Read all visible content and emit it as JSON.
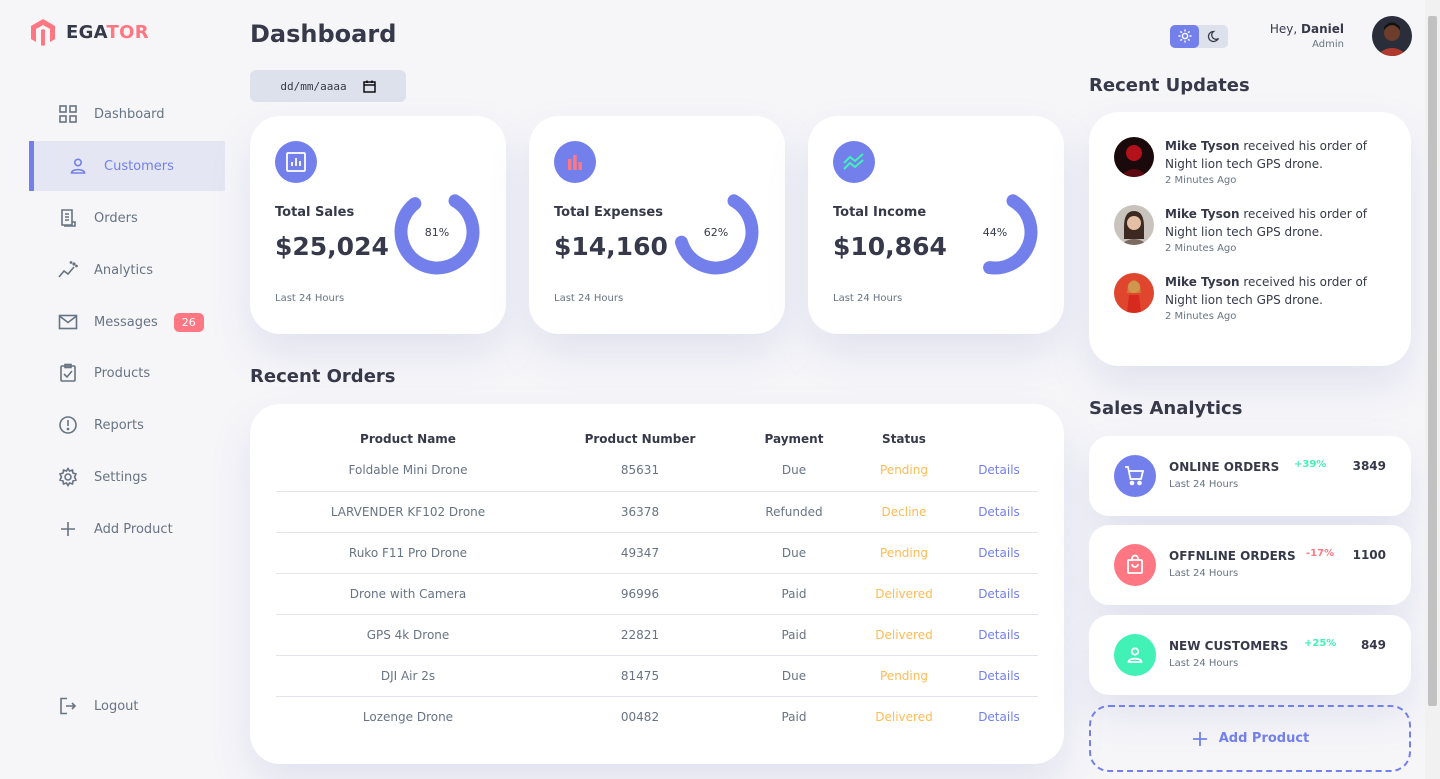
{
  "brand": {
    "name_main": "EGA",
    "name_accent": "TOR"
  },
  "sidebar": {
    "items": [
      {
        "label": "Dashboard",
        "icon": "grid-icon"
      },
      {
        "label": "Customers",
        "icon": "person-icon",
        "active": true
      },
      {
        "label": "Orders",
        "icon": "receipt-icon"
      },
      {
        "label": "Analytics",
        "icon": "insights-icon"
      },
      {
        "label": "Messages",
        "icon": "mail-icon",
        "badge": "26"
      },
      {
        "label": "Products",
        "icon": "inventory-icon"
      },
      {
        "label": "Reports",
        "icon": "report-icon"
      },
      {
        "label": "Settings",
        "icon": "gear-icon"
      },
      {
        "label": "Add Product",
        "icon": "plus-icon"
      }
    ],
    "logout_label": "Logout"
  },
  "main": {
    "title": "Dashboard",
    "date_placeholder": "dd/mm/aaaa",
    "cards": [
      {
        "label": "Total Sales",
        "amount": "$25,024",
        "percent": "81%",
        "value": 81,
        "footer": "Last 24 Hours",
        "icon": "analytics-icon"
      },
      {
        "label": "Total Expenses",
        "amount": "$14,160",
        "percent": "62%",
        "value": 62,
        "footer": "Last 24 Hours",
        "icon": "bar-chart-icon"
      },
      {
        "label": "Total Income",
        "amount": "$10,864",
        "percent": "44%",
        "value": 44,
        "footer": "Last 24 Hours",
        "icon": "stacked-line-chart-icon"
      }
    ],
    "recent_orders_title": "Recent Orders",
    "orders": {
      "headers": [
        "Product Name",
        "Product Number",
        "Payment",
        "Status",
        ""
      ],
      "rows": [
        {
          "name": "Foldable Mini Drone",
          "number": "85631",
          "payment": "Due",
          "status": "Pending",
          "action": "Details"
        },
        {
          "name": "LARVENDER KF102 Drone",
          "number": "36378",
          "payment": "Refunded",
          "status": "Decline",
          "action": "Details"
        },
        {
          "name": "Ruko F11 Pro Drone",
          "number": "49347",
          "payment": "Due",
          "status": "Pending",
          "action": "Details"
        },
        {
          "name": "Drone with Camera",
          "number": "96996",
          "payment": "Paid",
          "status": "Delivered",
          "action": "Details"
        },
        {
          "name": "GPS 4k Drone",
          "number": "22821",
          "payment": "Paid",
          "status": "Delivered",
          "action": "Details"
        },
        {
          "name": "DJI Air 2s",
          "number": "81475",
          "payment": "Due",
          "status": "Pending",
          "action": "Details"
        },
        {
          "name": "Lozenge Drone",
          "number": "00482",
          "payment": "Paid",
          "status": "Delivered",
          "action": "Details"
        }
      ]
    }
  },
  "header": {
    "greeting": "Hey, ",
    "user_name": "Daniel",
    "role": "Admin"
  },
  "updates": {
    "title": "Recent Updates",
    "items": [
      {
        "name": "Mike Tyson",
        "text": " received his order of Night lion tech GPS drone.",
        "time": "2 Minutes Ago",
        "avatar_color": "#b4121b"
      },
      {
        "name": "Mike Tyson",
        "text": " received his order of Night lion tech GPS drone.",
        "time": "2 Minutes Ago",
        "avatar_color": "#7a6a60"
      },
      {
        "name": "Mike Tyson",
        "text": " received his order of Night lion tech GPS drone.",
        "time": "2 Minutes Ago",
        "avatar_color": "#e0452e"
      }
    ]
  },
  "analytics": {
    "title": "Sales Analytics",
    "items": [
      {
        "name": "ONLINE ORDERS",
        "sub": "Last 24 Hours",
        "change": "+39%",
        "value": "3849",
        "color": "#7380ec",
        "change_color": "#41f1b6",
        "icon": "cart-icon"
      },
      {
        "name": "OFFNLINE ORDERS",
        "sub": "Last 24 Hours",
        "change": "-17%",
        "value": "1100",
        "color": "#ff7782",
        "change_color": "#ff7782",
        "icon": "shopping-bag-icon"
      },
      {
        "name": "NEW CUSTOMERS",
        "sub": "Last 24 Hours",
        "change": "+25%",
        "value": "849",
        "color": "#41f1b6",
        "change_color": "#41f1b6",
        "icon": "person-icon"
      }
    ],
    "add_product_label": "Add Product"
  },
  "colors": {
    "primary": "#7380ec",
    "danger": "#ff7782",
    "success": "#41f1b6",
    "warning": "#ffbb55"
  }
}
